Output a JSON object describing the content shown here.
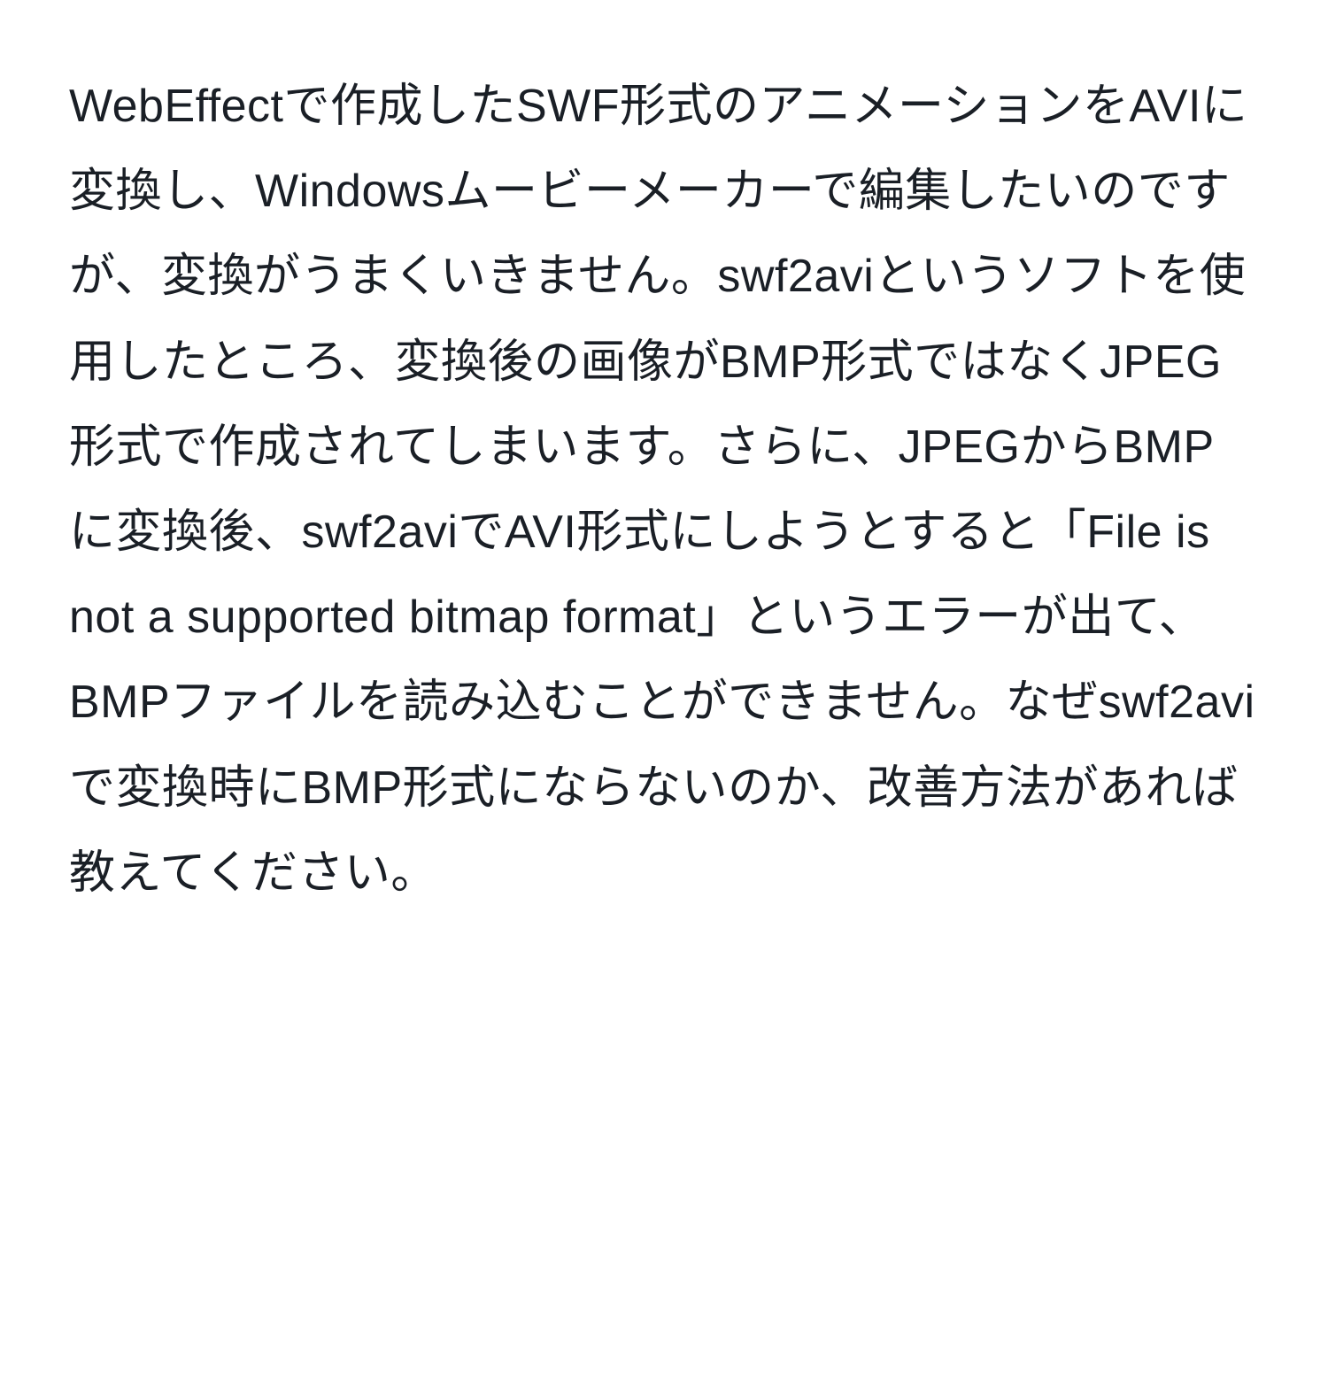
{
  "paragraph": "WebEffectで作成したSWF形式のアニメーションをAVIに変換し、Windowsムービーメーカーで編集したいのですが、変換がうまくいきません。swf2aviというソフトを使用したところ、変換後の画像がBMP形式ではなくJPEG形式で作成されてしまいます。さらに、JPEGからBMPに変換後、swf2aviでAVI形式にしようとすると「File is not a supported bitmap format」というエラーが出て、BMPファイルを読み込むことができません。なぜswf2aviで変換時にBMP形式にならないのか、改善方法があれば教えてください。"
}
